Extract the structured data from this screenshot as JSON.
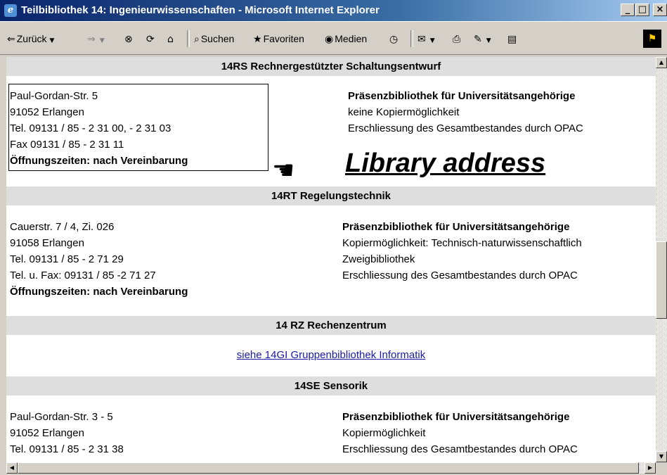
{
  "window": {
    "title": "Teilbibliothek 14: Ingenieurwissenschaften - Microsoft Internet Explorer",
    "min_glyph": "_",
    "max_glyph": "□",
    "close_glyph": "×"
  },
  "toolbar": {
    "back_label": "Zurück",
    "search_label": "Suchen",
    "favorites_label": "Favoriten",
    "media_label": "Medien"
  },
  "sections": [
    {
      "heading": "14RS Rechnergestützter Schaltungsentwurf",
      "address": [
        "Paul-Gordan-Str. 5",
        "91052 Erlangen",
        "Tel. 09131 / 85 - 2 31 00, - 2 31 03",
        "Fax 09131 / 85 - 2 31 11"
      ],
      "hours": "Öffnungszeiten: nach Vereinbarung",
      "info_title": "Präsenzbibliothek für Universitätsangehörige",
      "info": [
        "keine Kopiermöglichkeit",
        "Erschliessung des Gesamtbestandes durch OPAC"
      ]
    },
    {
      "heading": "14RT Regelungstechnik",
      "address": [
        "Cauerstr. 7 / 4, Zi. 026",
        "91058 Erlangen",
        "Tel. 09131 / 85 - 2 71 29",
        "Tel. u. Fax: 09131 / 85 -2 71 27"
      ],
      "hours": "Öffnungszeiten: nach Vereinbarung",
      "info_title": "Präsenzbibliothek für Universitätsangehörige",
      "info": [
        "Kopiermöglichkeit: Technisch-naturwissenschaftlich",
        "Zweigbibliothek",
        "Erschliessung des Gesamtbestandes durch OPAC"
      ]
    },
    {
      "heading": "14 RZ Rechenzentrum",
      "link": "siehe 14GI Gruppenbibliothek Informatik"
    },
    {
      "heading": "14SE Sensorik",
      "address": [
        "Paul-Gordan-Str. 3 - 5",
        "91052 Erlangen",
        "Tel. 09131 / 85 - 2 31 38"
      ],
      "info_title": "Präsenzbibliothek für Universitätsangehörige",
      "info": [
        "Kopiermöglichkeit",
        "Erschliessung des Gesamtbestandes durch OPAC"
      ]
    }
  ],
  "annotation": {
    "label": "Library address",
    "icon": "pointing-hand-icon"
  }
}
